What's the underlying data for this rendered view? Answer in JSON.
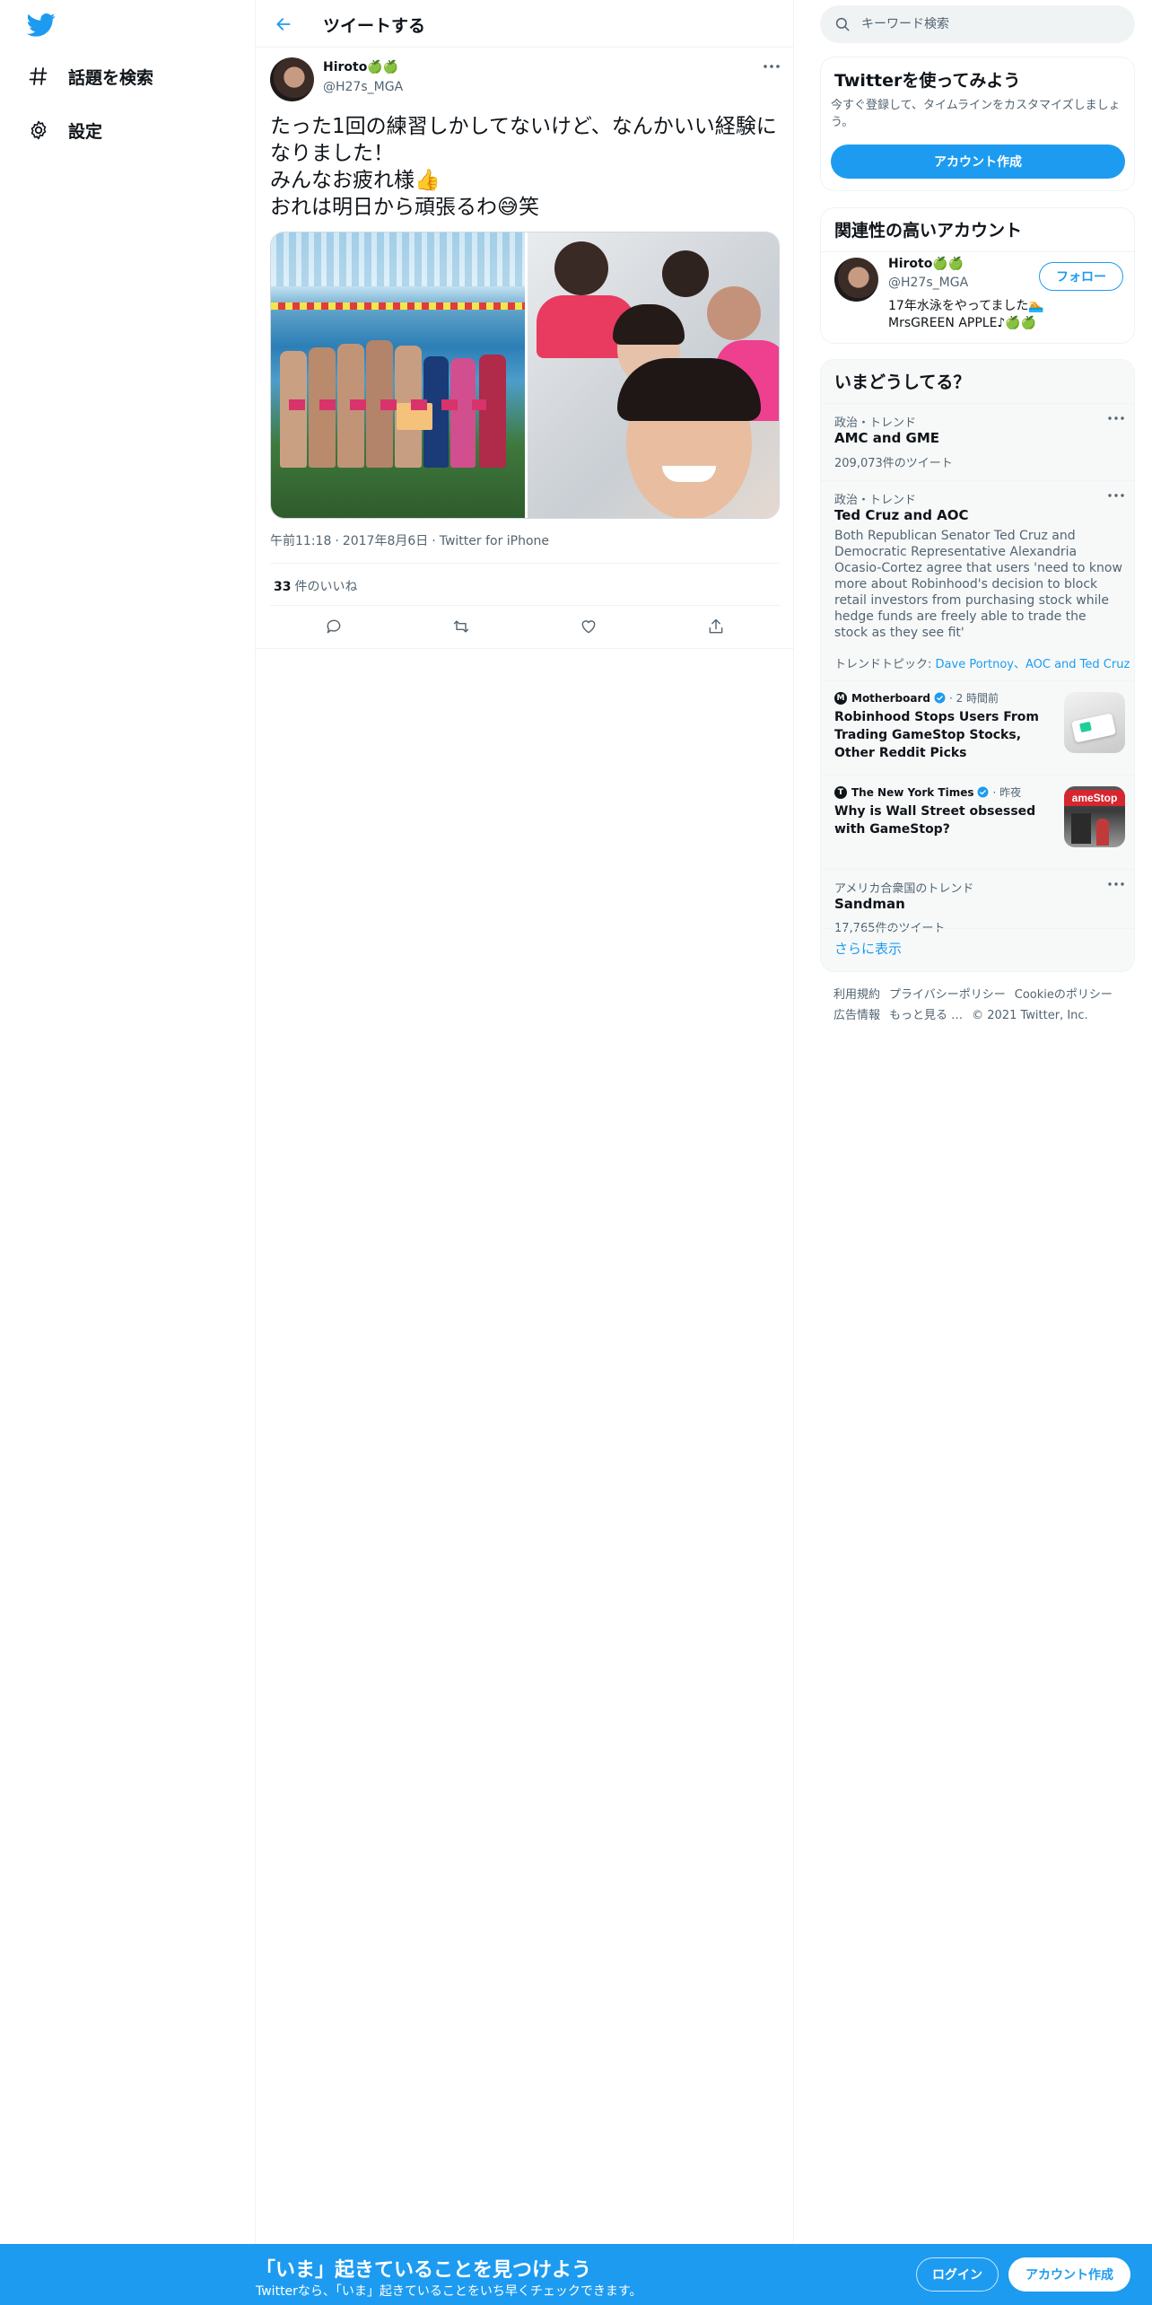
{
  "nav": {
    "items": [
      {
        "label": "話題を検索",
        "icon": "hashtag-icon"
      },
      {
        "label": "設定",
        "icon": "gear-icon"
      }
    ]
  },
  "header": {
    "title": "ツイートする"
  },
  "tweet": {
    "author_name": "Hiroto🍏🍏",
    "author_handle": "@H27s_MGA",
    "text": "たった1回の練習しかしてないけど、なんかいい経験になりました！\nみんなお疲れ様👍\nおれは明日から頑張るわ😅笑",
    "time": "午前11:18",
    "date": "2017年8月6日",
    "client": "Twitter for iPhone",
    "likes_count": "33",
    "likes_label": "件のいいね"
  },
  "search": {
    "placeholder": "キーワード検索"
  },
  "signup_card": {
    "title": "Twitterを使ってみよう",
    "description": "今すぐ登録して、タイムラインをカスタマイズしましょう。",
    "button": "アカウント作成"
  },
  "related": {
    "title": "関連性の高いアカウント",
    "name": "Hiroto🍏🍏",
    "handle": "@H27s_MGA",
    "bio": "17年水泳をやってました🏊\nMrsGREEN APPLE♪🍏🍏",
    "follow_label": "フォロー"
  },
  "trends": {
    "title": "いまどうしてる？",
    "items": [
      {
        "context": "政治・トレンド",
        "name": "AMC and GME",
        "count": "209,073件のツイート"
      },
      {
        "context": "政治・トレンド",
        "name": "Ted Cruz and AOC",
        "summary": "Both Republican Senator Ted Cruz and Democratic Representative Alexandria Ocasio-Cortez agree that users 'need to know more about Robinhood's decision to block retail investors from purchasing stock while hedge funds are freely able to trade the stock as they see fit'",
        "topics_label": "トレンドトピック:",
        "topics": "Dave Portnoy、AOC and Ted Cruz"
      },
      {
        "context": "アメリカ合衆国のトレンド",
        "name": "Sandman",
        "count": "17,765件のツイート"
      }
    ],
    "news": [
      {
        "source": "Motherboard",
        "time": "2 時間前",
        "headline": "Robinhood Stops Users From Trading GameStop Stocks, Other Reddit Picks"
      },
      {
        "source": "The New York Times",
        "time": "昨夜",
        "headline": "Why is Wall Street obsessed with GameStop?",
        "thumb_text": "ameStop"
      }
    ],
    "show_more": "さらに表示"
  },
  "footer": {
    "links": [
      "利用規約",
      "プライバシーポリシー",
      "Cookieのポリシー",
      "広告情報",
      "もっと見る …"
    ],
    "copyright": "© 2021 Twitter, Inc."
  },
  "bottom_bar": {
    "headline": "「いま」起きていることを見つけよう",
    "sub": "Twitterなら、「いま」起きていることをいち早くチェックできます。",
    "login": "ログイン",
    "signup": "アカウント作成"
  },
  "colors": {
    "accent": "#1d9bf0",
    "text": "#0f1419",
    "muted": "#536471",
    "border": "#eff3f4"
  }
}
